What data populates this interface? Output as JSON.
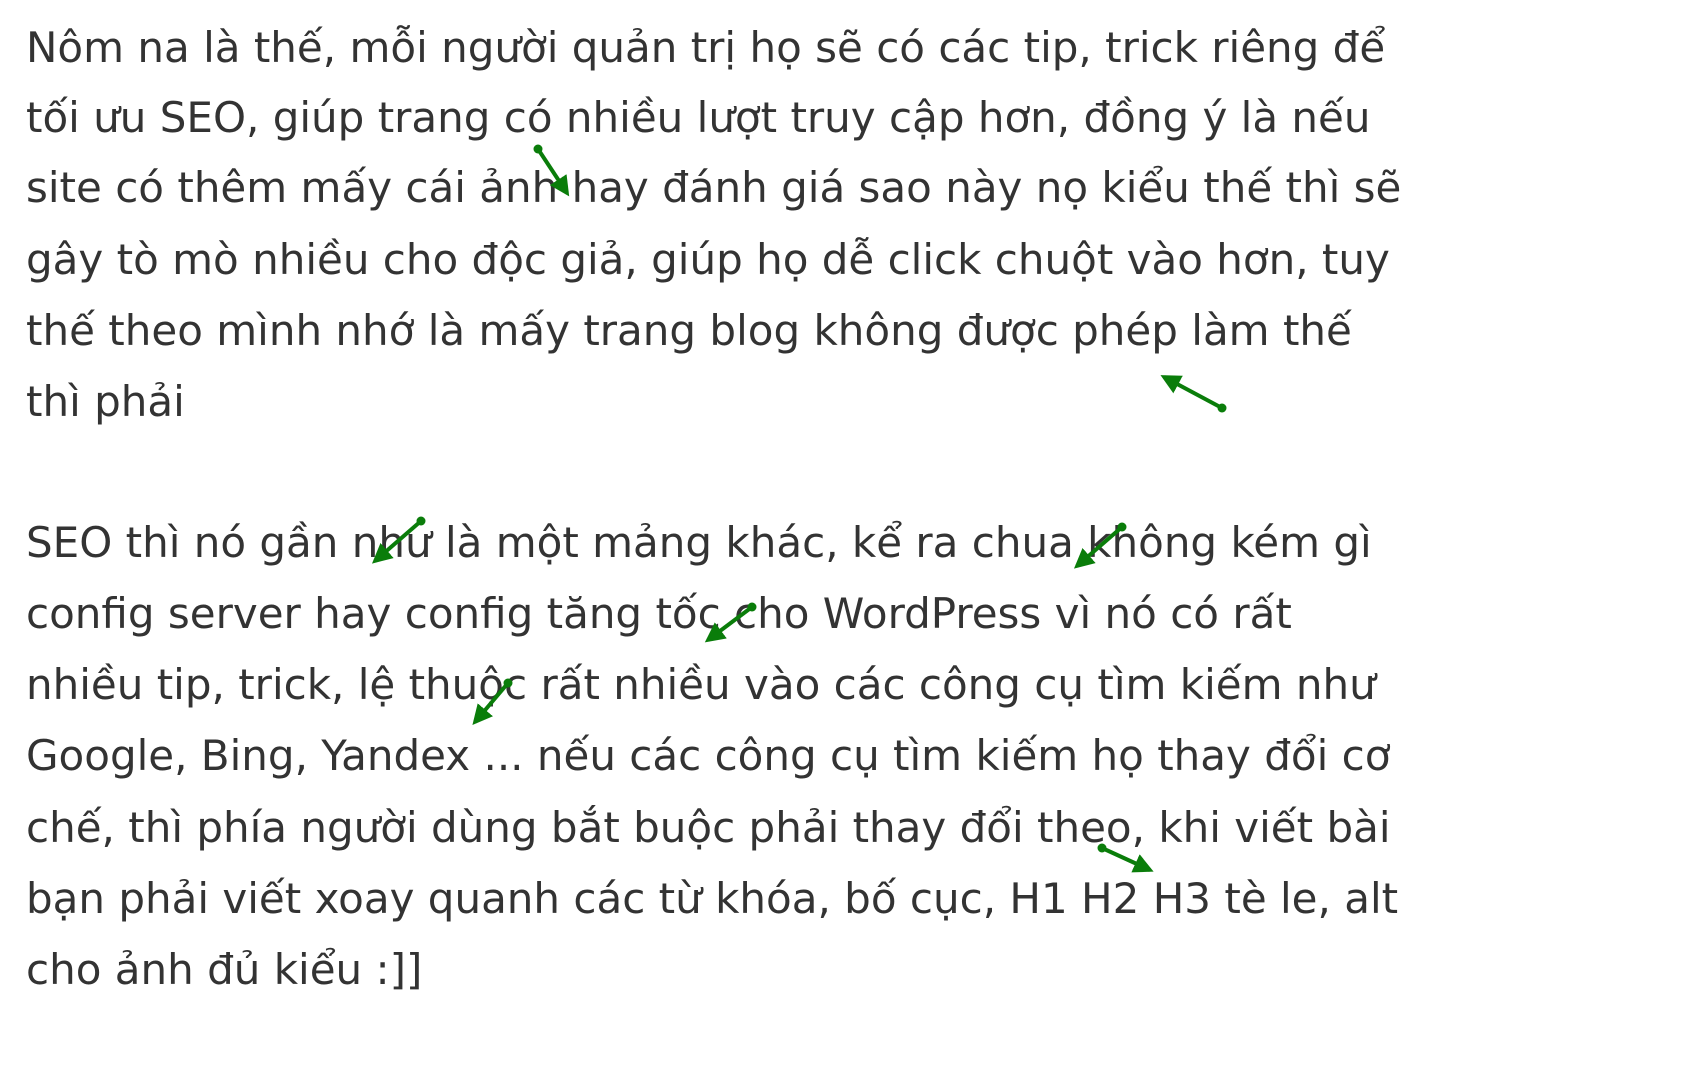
{
  "paragraphs": [
    {
      "lines": [
        "Nôm na là thế, mỗi người quản trị họ sẽ có các tip, trick riêng để",
        "tối ưu SEO, giúp trang có nhiều lượt truy cập hơn, đồng ý là nếu",
        "site có thêm mấy cái ảnh hay đánh giá sao này nọ kiểu thế thì sẽ",
        "gây tò mò nhiều cho độc giả, giúp họ dễ click chuột vào hơn, tuy",
        "thế theo mình nhớ là mấy trang blog không được phép làm thế",
        "thì phải"
      ]
    },
    {
      "lines": [
        "SEO thì nó gần như là một mảng khác, kể ra chua không kém gì",
        "config server hay config tăng tốc cho WordPress vì nó có rất",
        "nhiều tip, trick, lệ thuộc rất nhiều vào các công cụ tìm kiếm như",
        "Google, Bing, Yandex ... nếu các công cụ tìm kiếm họ thay đổi cơ",
        "chế, thì phía người dùng bắt buộc phải thay đổi theo, khi viết bài",
        "bạn phải viết xoay quanh các từ khóa, bố cục, H1 H2 H3 tè le, alt",
        "cho ảnh đủ kiểu :]]"
      ]
    }
  ],
  "annotation_color": "#0a7d0a",
  "text_color": "#333333"
}
